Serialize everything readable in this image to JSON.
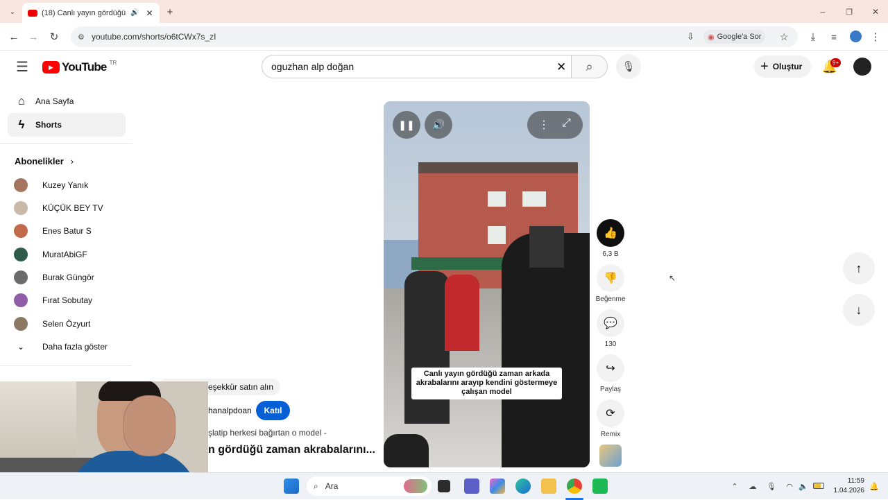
{
  "browser": {
    "tab_title": "(18) Canlı yayın gördüğü za",
    "url": "youtube.com/shorts/o6tCWx7s_zI",
    "google_ask": "Google'a Sor"
  },
  "youtube": {
    "logo_text": "YouTube",
    "region": "TR",
    "search_value": "oguzhan alp doğan",
    "create_label": "Oluştur",
    "notif_count": "9+"
  },
  "sidebar": {
    "home": "Ana Sayfa",
    "shorts": "Shorts",
    "subscriptions_heading": "Abonelikler",
    "subs": [
      "Kuzey Yanık",
      "KÜÇÜK BEY TV",
      "Enes Batur S",
      "MuratAbiGF",
      "Burak Güngör",
      "Fırat Sobutay",
      "Selen Özyurt"
    ],
    "show_more": "Daha fazla göster"
  },
  "short": {
    "caption": "Canlı yayın gördüğü zaman arkada akrabalarını arayıp kendini göstermeye çalışan model",
    "thanks_label": "eşekkür satın alın",
    "channel": "hanalpdoan",
    "join_label": "Katıl",
    "desc": "şlatip herkesi bağırtan o model -",
    "title": "n gördüğü zaman akrabalarını..."
  },
  "actions": {
    "likes": "6,3 B",
    "dislike": "Beğenme",
    "comments": "130",
    "share": "Paylaş",
    "remix": "Remix"
  },
  "taskbar": {
    "search": "Ara",
    "time": "11:59",
    "date": "1.04.2026"
  }
}
